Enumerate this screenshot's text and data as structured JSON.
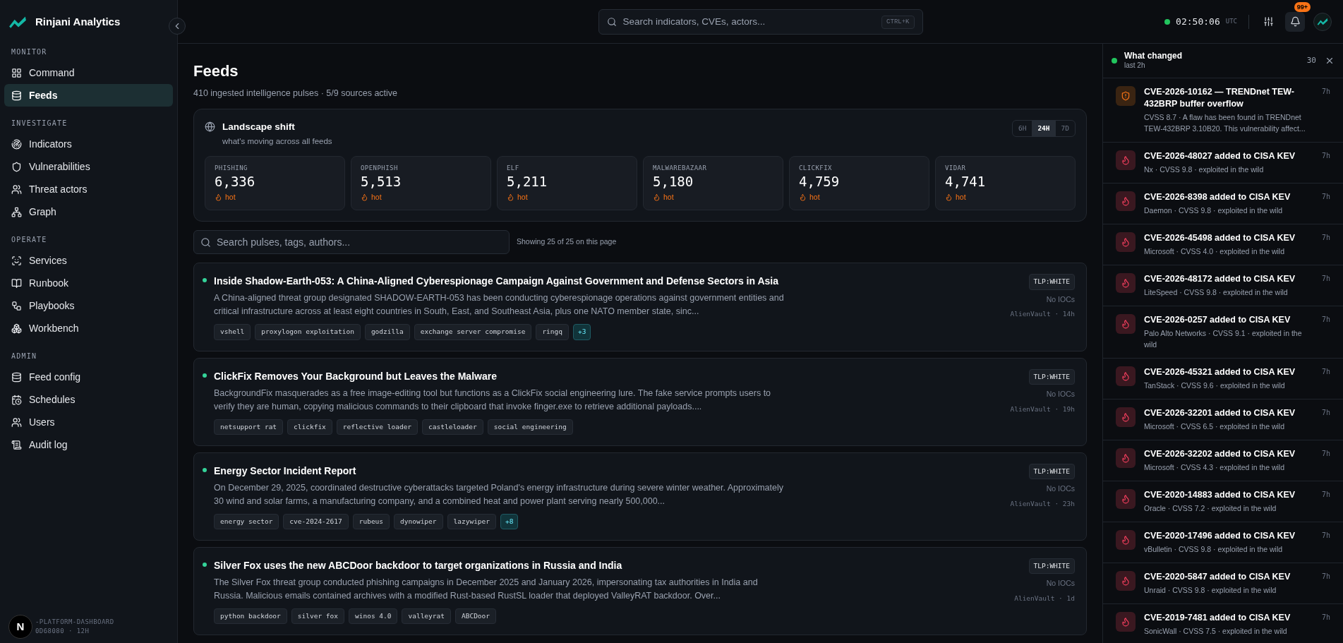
{
  "sidebar": {
    "brand": "Rinjani Analytics",
    "sections": [
      {
        "label": "MONITOR",
        "items": [
          {
            "label": "Command",
            "selected": false
          },
          {
            "label": "Feeds",
            "selected": true
          }
        ]
      },
      {
        "label": "INVESTIGATE",
        "items": [
          {
            "label": "Indicators",
            "selected": false
          },
          {
            "label": "Vulnerabilities",
            "selected": false
          },
          {
            "label": "Threat actors",
            "selected": false
          },
          {
            "label": "Graph",
            "selected": false
          }
        ]
      },
      {
        "label": "OPERATE",
        "items": [
          {
            "label": "Services",
            "selected": false
          },
          {
            "label": "Runbook",
            "selected": false
          },
          {
            "label": "Playbooks",
            "selected": false
          },
          {
            "label": "Workbench",
            "selected": false
          }
        ]
      },
      {
        "label": "ADMIN",
        "items": [
          {
            "label": "Feed config",
            "selected": false
          },
          {
            "label": "Schedules",
            "selected": false
          },
          {
            "label": "Users",
            "selected": false
          },
          {
            "label": "Audit log",
            "selected": false
          }
        ]
      }
    ],
    "footer": [
      "-PLATFORM-DASHBOARD",
      "0D68080 · 12H"
    ],
    "dev_badge": "N"
  },
  "topbar": {
    "search": {
      "placeholder": "Search indicators, CVEs, actors...",
      "shortcut": "CTRL+K"
    },
    "clock": "02:50:06",
    "timezone": "UTC",
    "notifications": "99+"
  },
  "main": {
    "title": "Feeds",
    "subtitle": "410 ingested intelligence pulses · 5/9 sources active",
    "landscape": {
      "title": "Landscape shift",
      "subtitle": "what's moving across all feeds",
      "ranges": [
        {
          "label": "6H",
          "selected": false
        },
        {
          "label": "24H",
          "selected": true
        },
        {
          "label": "7D",
          "selected": false
        }
      ],
      "stats": [
        {
          "label": "PHISHING",
          "value": "6,336",
          "trend": "hot"
        },
        {
          "label": "OPENPHISH",
          "value": "5,513",
          "trend": "hot"
        },
        {
          "label": "ELF",
          "value": "5,211",
          "trend": "hot"
        },
        {
          "label": "MALWAREBAZAAR",
          "value": "5,180",
          "trend": "hot"
        },
        {
          "label": "CLICKFIX",
          "value": "4,759",
          "trend": "hot"
        },
        {
          "label": "VIDAR",
          "value": "4,741",
          "trend": "hot"
        }
      ]
    },
    "search": {
      "placeholder": "Search pulses, tags, authors..."
    },
    "showing": "Showing 25 of 25 on this page",
    "feeds": [
      {
        "title": "Inside Shadow-Earth-053: A China-Aligned Cyberespionage Campaign Against Government and Defense Sectors in Asia",
        "description": "A China-aligned threat group designated SHADOW-EARTH-053 has been conducting cyberespionage operations against government entities and critical infrastructure across at least eight countries in South, East, and Southeast Asia, plus one NATO member state, sinc...",
        "tags": [
          "vshell",
          "proxylogon exploitation",
          "godzilla",
          "exchange server compromise",
          "ringq"
        ],
        "more": "+3",
        "tlp": "TLP:WHITE",
        "iocs": "No IOCs",
        "source": "AlienVault · 14h"
      },
      {
        "title": "ClickFix Removes Your Background but Leaves the Malware",
        "description": "BackgroundFix masquerades as a free image-editing tool but functions as a ClickFix social engineering lure. The fake service prompts users to verify they are human, copying malicious commands to their clipboard that invoke finger.exe to retrieve additional payloads....",
        "tags": [
          "netsupport rat",
          "clickfix",
          "reflective loader",
          "castleloader",
          "social engineering"
        ],
        "tlp": "TLP:WHITE",
        "iocs": "No IOCs",
        "source": "AlienVault · 19h"
      },
      {
        "title": "Energy Sector Incident Report",
        "description": "On December 29, 2025, coordinated destructive cyberattacks targeted Poland's energy infrastructure during severe winter weather. Approximately 30 wind and solar farms, a manufacturing company, and a combined heat and power plant serving nearly 500,000...",
        "tags": [
          "energy sector",
          "cve-2024-2617",
          "rubeus",
          "dynowiper",
          "lazywiper"
        ],
        "more": "+8",
        "tlp": "TLP:WHITE",
        "iocs": "No IOCs",
        "source": "AlienVault · 23h"
      },
      {
        "title": "Silver Fox uses the new ABCDoor backdoor to target organizations in Russia and India",
        "description": "The Silver Fox threat group conducted phishing campaigns in December 2025 and January 2026, impersonating tax authorities in India and Russia. Malicious emails contained archives with a modified Rust-based RustSL loader that deployed ValleyRAT backdoor. Over...",
        "tags": [
          "python backdoor",
          "silver fox",
          "winos 4.0",
          "valleyrat",
          "ABCDoor"
        ],
        "tlp": "TLP:WHITE",
        "iocs": "No IOCs",
        "source": "AlienVault · 1d"
      }
    ]
  },
  "changes": {
    "title": "What changed",
    "subtitle": "last 2h",
    "count": "30",
    "items": [
      {
        "kind": "advisory",
        "title": "CVE-2026-10162 — TRENDnet TEW-432BRP buffer overflow",
        "meta": "CVSS 8.7 · A flaw has been found in TRENDnet TEW-432BRP 3.10B20. This vulnerability affect...",
        "time": "7h"
      },
      {
        "kind": "kev",
        "title": "CVE-2026-48027 added to CISA KEV",
        "meta": "Nx · CVSS 9.8 · exploited in the wild",
        "time": "7h"
      },
      {
        "kind": "kev",
        "title": "CVE-2026-8398 added to CISA KEV",
        "meta": "Daemon · CVSS 9.8 · exploited in the wild",
        "time": "7h"
      },
      {
        "kind": "kev",
        "title": "CVE-2026-45498 added to CISA KEV",
        "meta": "Microsoft · CVSS 4.0 · exploited in the wild",
        "time": "7h"
      },
      {
        "kind": "kev",
        "title": "CVE-2026-48172 added to CISA KEV",
        "meta": "LiteSpeed · CVSS 9.8 · exploited in the wild",
        "time": "7h"
      },
      {
        "kind": "kev",
        "title": "CVE-2026-0257 added to CISA KEV",
        "meta": "Palo Alto Networks · CVSS 9.1 · exploited in the wild",
        "time": "7h"
      },
      {
        "kind": "kev",
        "title": "CVE-2026-45321 added to CISA KEV",
        "meta": "TanStack · CVSS 9.6 · exploited in the wild",
        "time": "7h"
      },
      {
        "kind": "kev",
        "title": "CVE-2026-32201 added to CISA KEV",
        "meta": "Microsoft · CVSS 6.5 · exploited in the wild",
        "time": "7h"
      },
      {
        "kind": "kev",
        "title": "CVE-2026-32202 added to CISA KEV",
        "meta": "Microsoft · CVSS 4.3 · exploited in the wild",
        "time": "7h"
      },
      {
        "kind": "kev",
        "title": "CVE-2020-14883 added to CISA KEV",
        "meta": "Oracle · CVSS 7.2 · exploited in the wild",
        "time": "7h"
      },
      {
        "kind": "kev",
        "title": "CVE-2020-17496 added to CISA KEV",
        "meta": "vBulletin · CVSS 9.8 · exploited in the wild",
        "time": "7h"
      },
      {
        "kind": "kev",
        "title": "CVE-2020-5847 added to CISA KEV",
        "meta": "Unraid · CVSS 9.8 · exploited in the wild",
        "time": "7h"
      },
      {
        "kind": "kev",
        "title": "CVE-2019-7481 added to CISA KEV",
        "meta": "SonicWall · CVSS 7.5 · exploited in the wild",
        "time": "7h"
      }
    ]
  }
}
